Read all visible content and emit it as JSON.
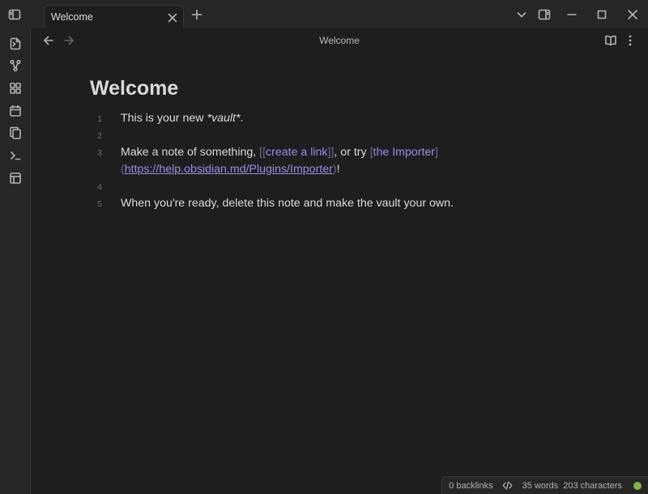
{
  "tab": {
    "title": "Welcome"
  },
  "nav": {
    "title": "Welcome"
  },
  "note": {
    "heading": "Welcome",
    "lines": [
      {
        "num": "1",
        "text_before": "This is your new ",
        "emph": "*vault*",
        "text_after": "."
      },
      {
        "num": "2"
      },
      {
        "num": "3",
        "text_before": "Make a note of something, ",
        "wikilink_open": "[[",
        "wikilink": "create a link",
        "wikilink_close": "]]",
        "mid": ", or try ",
        "md_open": "[",
        "md_text": "the Importer",
        "md_close": "]",
        "paren_open": "(",
        "url": "https://help.obsidian.md/Plugins/Importer",
        "paren_close": ")",
        "end": "!"
      },
      {
        "num": "4"
      },
      {
        "num": "5",
        "text": "When you're ready, delete this note and make the vault your own."
      }
    ]
  },
  "status": {
    "backlinks": "0 backlinks",
    "words": "35 words",
    "characters": "203 characters"
  },
  "colors": {
    "accent": "#9c8ce6",
    "sync": "#7ab648"
  }
}
